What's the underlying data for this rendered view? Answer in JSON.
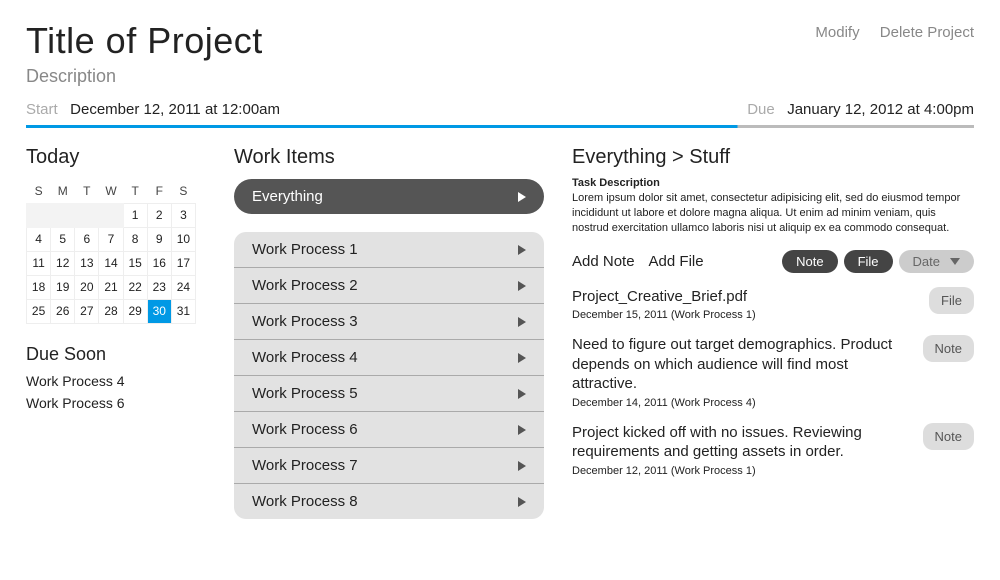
{
  "header": {
    "title": "Title of Project",
    "description": "Description",
    "modify": "Modify",
    "delete": "Delete Project",
    "start_label": "Start",
    "start_value": "December 12, 2011 at 12:00am",
    "due_label": "Due",
    "due_value": "January 12, 2012 at 4:00pm"
  },
  "left": {
    "today_h": "Today",
    "dow": [
      "S",
      "M",
      "T",
      "W",
      "T",
      "F",
      "S"
    ],
    "weeks": [
      [
        "",
        "",
        "",
        "",
        "1",
        "2",
        "3"
      ],
      [
        "4",
        "5",
        "6",
        "7",
        "8",
        "9",
        "10"
      ],
      [
        "11",
        "12",
        "13",
        "14",
        "15",
        "16",
        "17"
      ],
      [
        "18",
        "19",
        "20",
        "21",
        "22",
        "23",
        "24"
      ],
      [
        "25",
        "26",
        "27",
        "28",
        "29",
        "30",
        "31"
      ]
    ],
    "today_cell": "30",
    "due_soon_h": "Due Soon",
    "due_soon": [
      "Work Process 4",
      "Work Process 6"
    ]
  },
  "mid": {
    "h": "Work Items",
    "everything": "Everything",
    "items": [
      "Work Process 1",
      "Work Process 2",
      "Work Process 3",
      "Work Process 4",
      "Work Process 5",
      "Work Process 6",
      "Work Process 7",
      "Work Process 8"
    ]
  },
  "right": {
    "breadcrumb": "Everything > Stuff",
    "task_desc_label": "Task Description",
    "task_desc": "Lorem ipsum dolor sit amet, consectetur adipisicing elit, sed do eiusmod tempor incididunt ut labore et dolore magna aliqua. Ut enim ad minim veniam, quis nostrud exercitation ullamco laboris nisi ut aliquip ex ea commodo consequat.",
    "add_note": "Add Note",
    "add_file": "Add File",
    "filter_note": "Note",
    "filter_file": "File",
    "filter_date": "Date",
    "feed": [
      {
        "title": "Project_Creative_Brief.pdf",
        "meta": "December 15, 2011 (Work Process 1)",
        "badge": "File"
      },
      {
        "title": "Need to figure out target demographics. Product depends on which audience will find most attractive.",
        "meta": "December 14, 2011 (Work Process 4)",
        "badge": "Note"
      },
      {
        "title": "Project kicked off with no issues. Reviewing requirements and getting assets in order.",
        "meta": "December 12, 2011 (Work Process 1)",
        "badge": "Note"
      }
    ]
  }
}
